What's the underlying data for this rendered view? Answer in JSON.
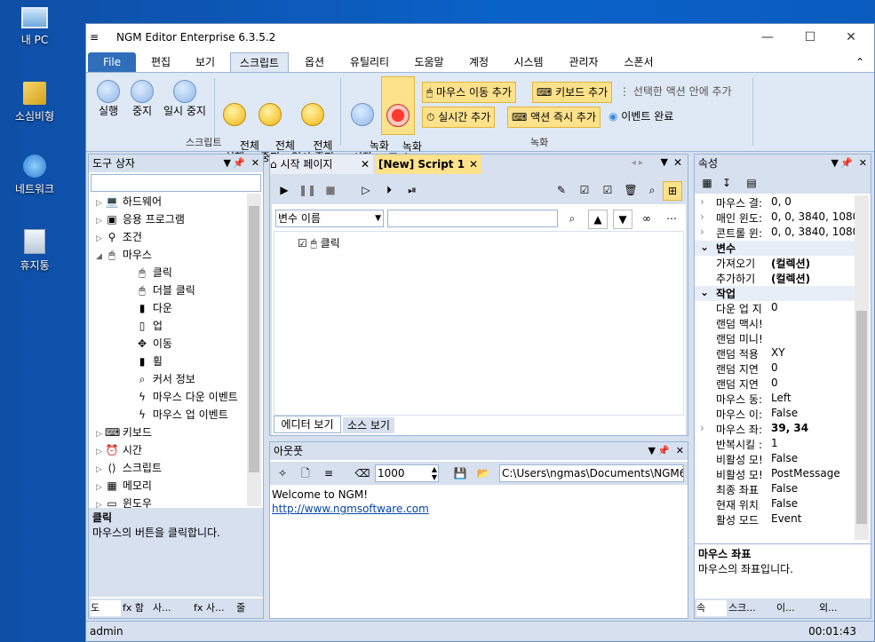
{
  "desktop": {
    "icons": [
      {
        "label": "내 PC"
      },
      {
        "label": "소심비형"
      },
      {
        "label": "네트워크"
      },
      {
        "label": "휴지통"
      }
    ]
  },
  "window": {
    "title": "NGM Editor   Enterprise 6.3.5.2",
    "controls": {
      "minimize": "—",
      "maximize": "☐",
      "close": "✕"
    }
  },
  "menu_tabs": [
    "File",
    "편집",
    "보기",
    "스크립트",
    "옵션",
    "유틸리티",
    "도움말",
    "계정",
    "시스템",
    "관리자",
    "스폰서"
  ],
  "ribbon": {
    "script_group": {
      "label": "스크립트",
      "buttons": [
        {
          "label": "실행"
        },
        {
          "label": "중지"
        },
        {
          "label": "일시 중지"
        },
        {
          "label": "전체\n실행"
        },
        {
          "label": "전체\n중지"
        },
        {
          "label": "전체\n일시 중지"
        }
      ]
    },
    "record_group": {
      "label": "녹화",
      "start": "녹화\n시작",
      "stop": "녹화\n중지",
      "mouse_move": "마우스 이동 추가",
      "keyboard": "키보드 추가",
      "add_in_action": "선택한 액션 안에 추가",
      "realtime": "실시간 추가",
      "instant": "액션 즉시 추가",
      "event_done": "이벤트 완료"
    }
  },
  "toolbox": {
    "title": "도구 상자",
    "items": [
      {
        "label": "하드웨어",
        "level": 0,
        "arrow": "▷",
        "icon": "💻"
      },
      {
        "label": "응용 프로그램",
        "level": 0,
        "arrow": "▷",
        "icon": "▣"
      },
      {
        "label": "조건",
        "level": 0,
        "arrow": "▷",
        "icon": "⚲"
      },
      {
        "label": "마우스",
        "level": 0,
        "arrow": "◢",
        "icon": "🖱"
      },
      {
        "label": "클릭",
        "level": 1,
        "arrow": "",
        "icon": "🖱"
      },
      {
        "label": "더블 클릭",
        "level": 1,
        "arrow": "",
        "icon": "🖱"
      },
      {
        "label": "다운",
        "level": 1,
        "arrow": "",
        "icon": "▮"
      },
      {
        "label": "업",
        "level": 1,
        "arrow": "",
        "icon": "▯"
      },
      {
        "label": "이동",
        "level": 1,
        "arrow": "",
        "icon": "✥"
      },
      {
        "label": "휠",
        "level": 1,
        "arrow": "",
        "icon": "▮"
      },
      {
        "label": "커서 정보",
        "level": 1,
        "arrow": "",
        "icon": "⌕"
      },
      {
        "label": "마우스 다운 이벤트",
        "level": 1,
        "arrow": "",
        "icon": "ϟ"
      },
      {
        "label": "마우스 업 이벤트",
        "level": 1,
        "arrow": "",
        "icon": "ϟ"
      },
      {
        "label": "키보드",
        "level": 0,
        "arrow": "▷",
        "icon": "⌨"
      },
      {
        "label": "시간",
        "level": 0,
        "arrow": "▷",
        "icon": "⏰"
      },
      {
        "label": "스크립트",
        "level": 0,
        "arrow": "▷",
        "icon": "⟨⟩"
      },
      {
        "label": "메모리",
        "level": 0,
        "arrow": "▷",
        "icon": "▦"
      },
      {
        "label": "윈도우",
        "level": 0,
        "arrow": "▷",
        "icon": "▭"
      }
    ],
    "desc_title": "클릭",
    "desc_text": "마우스의 버튼을 클릭합니다.",
    "bottom_tabs": [
      "도",
      "fx 함",
      "사...",
      "fx 사...",
      "줄"
    ]
  },
  "editor": {
    "tabs": [
      {
        "label": "시작 페이지"
      },
      {
        "label": "[New] Script 1"
      }
    ],
    "var_select": "변수 이름",
    "search_value": "",
    "tree_item": "클릭",
    "view_tabs": [
      "에디터 보기",
      "소스 보기"
    ]
  },
  "output": {
    "title": "아웃풋",
    "count": "1000",
    "path": "C:\\Users\\ngmas\\Documents\\NGM6\\",
    "welcome": "Welcome to NGM!",
    "link": "http://www.ngmsoftware.com"
  },
  "properties": {
    "title": "속성",
    "rows": [
      {
        "type": "row",
        "k": "마우스 결:",
        "v": "0, 0",
        "exp": true
      },
      {
        "type": "row",
        "k": "매인 윈도:",
        "v": "0, 0, 3840, 1080",
        "exp": true
      },
      {
        "type": "row",
        "k": "콘트롤 윈:",
        "v": "0, 0, 3840, 1080",
        "exp": true
      },
      {
        "type": "cat",
        "k": "변수"
      },
      {
        "type": "row",
        "k": "가져오기",
        "v": "(컬렉션)",
        "bold": true
      },
      {
        "type": "row",
        "k": "추가하기",
        "v": "(컬렉션)",
        "bold": true
      },
      {
        "type": "cat",
        "k": "작업"
      },
      {
        "type": "row",
        "k": "다운 업 지",
        "v": "0"
      },
      {
        "type": "row",
        "k": "랜덤 맥시!",
        "v": ""
      },
      {
        "type": "row",
        "k": "랜덤 미니!",
        "v": ""
      },
      {
        "type": "row",
        "k": "랜덤 적용",
        "v": "XY"
      },
      {
        "type": "row",
        "k": "랜덤 지연",
        "v": "0"
      },
      {
        "type": "row",
        "k": "랜덤 지연",
        "v": "0"
      },
      {
        "type": "row",
        "k": "마우스 동:",
        "v": "Left"
      },
      {
        "type": "row",
        "k": "마우스 이:",
        "v": "False"
      },
      {
        "type": "row",
        "k": "마우스 좌:",
        "v": "39, 34",
        "bold": true,
        "exp": true
      },
      {
        "type": "row",
        "k": "반복시킬 :",
        "v": "1"
      },
      {
        "type": "row",
        "k": "비활성 모!",
        "v": "False"
      },
      {
        "type": "row",
        "k": "비활성 모!",
        "v": "PostMessage"
      },
      {
        "type": "row",
        "k": "최종 좌표",
        "v": "False"
      },
      {
        "type": "row",
        "k": "현재 위치",
        "v": "False"
      },
      {
        "type": "row",
        "k": "활성 모드",
        "v": "Event"
      }
    ],
    "desc_title": "마우스 좌표",
    "desc_text": "마우스의 좌표입니다.",
    "bottom_tabs": [
      "속",
      "스크...",
      "이...",
      "외..."
    ]
  },
  "status": {
    "user": "admin",
    "time": "00:01:43"
  },
  "colors": {
    "accent": "#2f6eb9",
    "highlight": "#fde28b",
    "record": "#ff3b30"
  }
}
